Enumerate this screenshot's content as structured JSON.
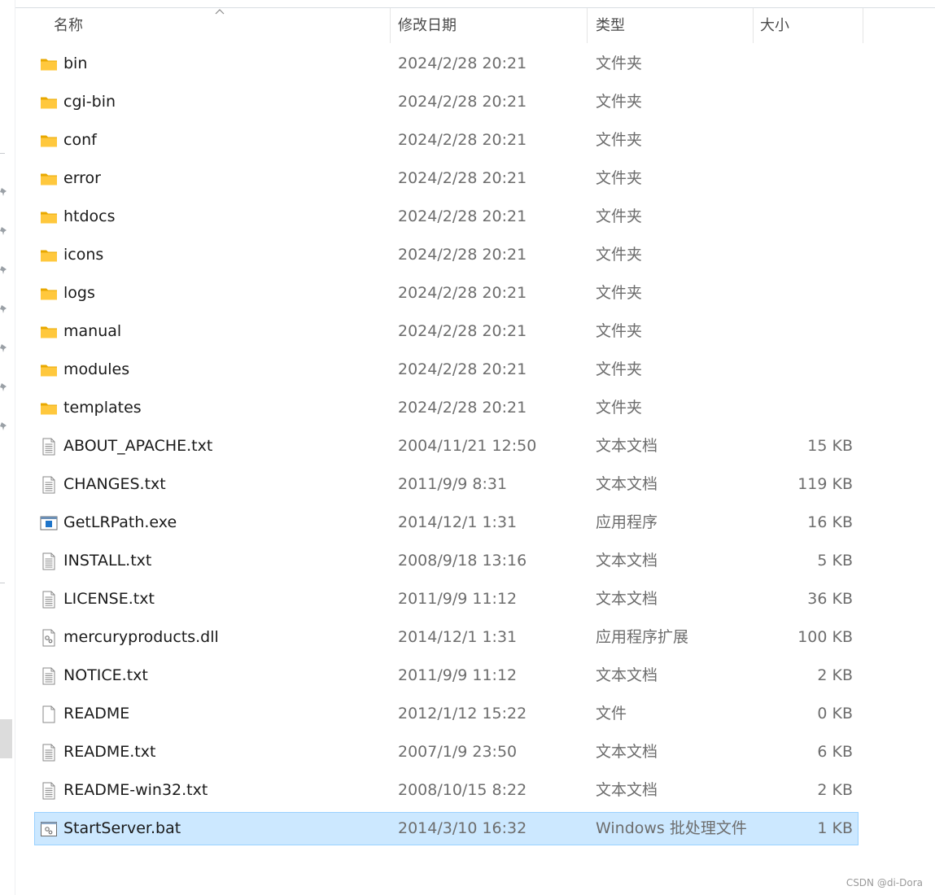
{
  "columns": {
    "name": "名称",
    "date": "修改日期",
    "type": "类型",
    "size": "大小"
  },
  "files": [
    {
      "name": "bin",
      "date": "2024/2/28 20:21",
      "type": "文件夹",
      "size": "",
      "icon": "folder-icon"
    },
    {
      "name": "cgi-bin",
      "date": "2024/2/28 20:21",
      "type": "文件夹",
      "size": "",
      "icon": "folder-icon"
    },
    {
      "name": "conf",
      "date": "2024/2/28 20:21",
      "type": "文件夹",
      "size": "",
      "icon": "folder-icon"
    },
    {
      "name": "error",
      "date": "2024/2/28 20:21",
      "type": "文件夹",
      "size": "",
      "icon": "folder-icon"
    },
    {
      "name": "htdocs",
      "date": "2024/2/28 20:21",
      "type": "文件夹",
      "size": "",
      "icon": "folder-icon"
    },
    {
      "name": "icons",
      "date": "2024/2/28 20:21",
      "type": "文件夹",
      "size": "",
      "icon": "folder-icon"
    },
    {
      "name": "logs",
      "date": "2024/2/28 20:21",
      "type": "文件夹",
      "size": "",
      "icon": "folder-icon"
    },
    {
      "name": "manual",
      "date": "2024/2/28 20:21",
      "type": "文件夹",
      "size": "",
      "icon": "folder-icon"
    },
    {
      "name": "modules",
      "date": "2024/2/28 20:21",
      "type": "文件夹",
      "size": "",
      "icon": "folder-icon"
    },
    {
      "name": "templates",
      "date": "2024/2/28 20:21",
      "type": "文件夹",
      "size": "",
      "icon": "folder-icon"
    },
    {
      "name": "ABOUT_APACHE.txt",
      "date": "2004/11/21 12:50",
      "type": "文本文档",
      "size": "15 KB",
      "icon": "text-file-icon"
    },
    {
      "name": "CHANGES.txt",
      "date": "2011/9/9 8:31",
      "type": "文本文档",
      "size": "119 KB",
      "icon": "text-file-icon"
    },
    {
      "name": "GetLRPath.exe",
      "date": "2014/12/1 1:31",
      "type": "应用程序",
      "size": "16 KB",
      "icon": "exe-file-icon"
    },
    {
      "name": "INSTALL.txt",
      "date": "2008/9/18 13:16",
      "type": "文本文档",
      "size": "5 KB",
      "icon": "text-file-icon"
    },
    {
      "name": "LICENSE.txt",
      "date": "2011/9/9 11:12",
      "type": "文本文档",
      "size": "36 KB",
      "icon": "text-file-icon"
    },
    {
      "name": "mercuryproducts.dll",
      "date": "2014/12/1 1:31",
      "type": "应用程序扩展",
      "size": "100 KB",
      "icon": "dll-file-icon"
    },
    {
      "name": "NOTICE.txt",
      "date": "2011/9/9 11:12",
      "type": "文本文档",
      "size": "2 KB",
      "icon": "text-file-icon"
    },
    {
      "name": "README",
      "date": "2012/1/12 15:22",
      "type": "文件",
      "size": "0 KB",
      "icon": "blank-file-icon"
    },
    {
      "name": "README.txt",
      "date": "2007/1/9 23:50",
      "type": "文本文档",
      "size": "6 KB",
      "icon": "text-file-icon"
    },
    {
      "name": "README-win32.txt",
      "date": "2008/10/15 8:22",
      "type": "文本文档",
      "size": "2 KB",
      "icon": "text-file-icon"
    },
    {
      "name": "StartServer.bat",
      "date": "2014/3/10 16:32",
      "type": "Windows 批处理文件",
      "size": "1 KB",
      "icon": "bat-file-icon",
      "selected": true
    }
  ],
  "watermark": "CSDN @di-Dora",
  "colors": {
    "selection_bg": "#cce8ff",
    "selection_border": "#99d1ff",
    "folder": "#ffc83d"
  }
}
